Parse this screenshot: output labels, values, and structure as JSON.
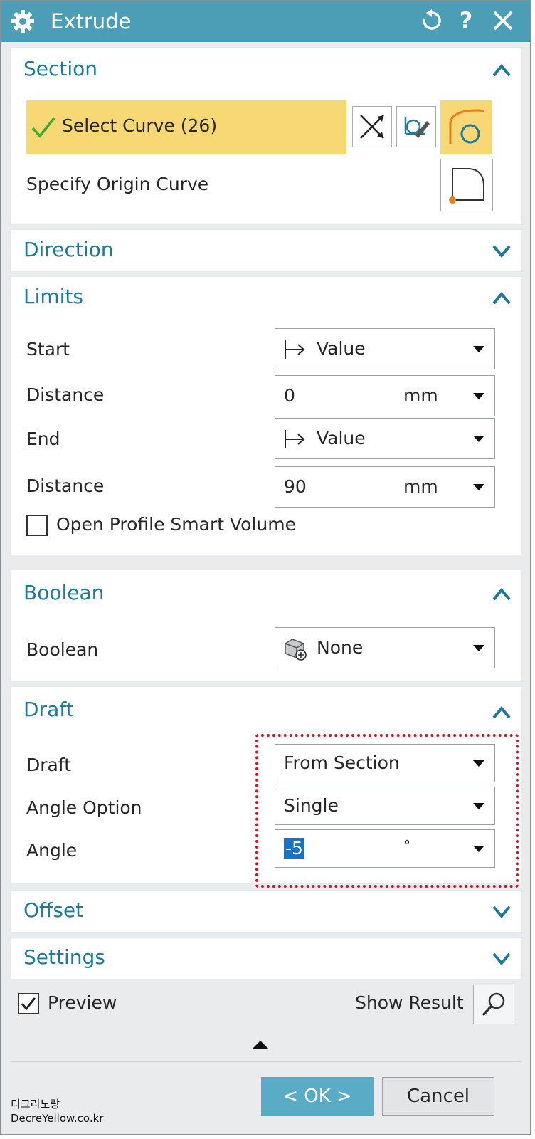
{
  "window": {
    "title": "Extrude",
    "help_label": "?"
  },
  "section": {
    "title": "Section",
    "select_curve_label": "Select Curve (26)",
    "specify_origin_label": "Specify Origin Curve"
  },
  "direction": {
    "title": "Direction"
  },
  "limits": {
    "title": "Limits",
    "start_label": "Start",
    "start_value": "Value",
    "start_distance_label": "Distance",
    "start_distance_value": "0",
    "start_distance_unit": "mm",
    "end_label": "End",
    "end_value": "Value",
    "end_distance_label": "Distance",
    "end_distance_value": "90",
    "end_distance_unit": "mm",
    "open_profile_label": "Open Profile Smart Volume",
    "open_profile_checked": false
  },
  "boolean": {
    "title": "Boolean",
    "label": "Boolean",
    "value": "None"
  },
  "draft": {
    "title": "Draft",
    "draft_label": "Draft",
    "draft_value": "From Section",
    "angle_option_label": "Angle Option",
    "angle_option_value": "Single",
    "angle_label": "Angle",
    "angle_value": "-5",
    "angle_unit": "°"
  },
  "offset": {
    "title": "Offset"
  },
  "settings": {
    "title": "Settings"
  },
  "footer": {
    "preview_label": "Preview",
    "preview_checked": true,
    "show_result_label": "Show Result",
    "ok_label": "< OK >",
    "cancel_label": "Cancel"
  },
  "watermark": {
    "line1": "디크리노랑",
    "line2": "DecreYellow.co.kr"
  },
  "colors": {
    "titlebar": "#4b9eb6",
    "section_title": "#1f7a98",
    "selection_highlight": "#f8d874",
    "ok_button": "#5aabc6",
    "annotation_border": "#d0122b"
  }
}
